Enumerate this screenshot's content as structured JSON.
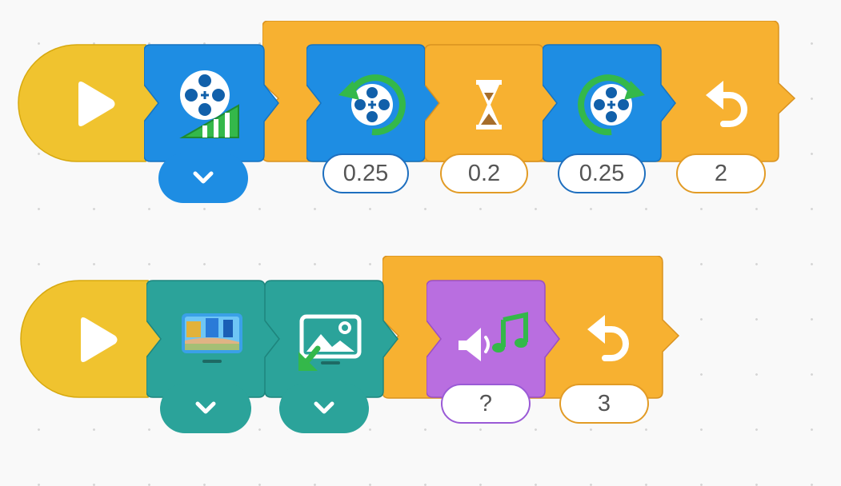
{
  "program": {
    "row1": {
      "start": {
        "icon": "play-triangle-icon",
        "color": "#f0c32f"
      },
      "motor_speed": {
        "icon": "motor-speed-icon",
        "color": "#1e8de3",
        "dropdown_icon": "chevron-down-icon"
      },
      "repeat": {
        "color": "#f7b131",
        "icon": "repeat-arrow-icon",
        "count": "2",
        "children": [
          {
            "block": "rotate-counterclockwise",
            "icon": "rotate-counterclockwise-icon",
            "color": "#1e8de3",
            "value": "0.25"
          },
          {
            "block": "wait",
            "icon": "hourglass-icon",
            "color": "#f7b131",
            "value": "0.2"
          },
          {
            "block": "rotate-clockwise",
            "icon": "rotate-clockwise-icon",
            "color": "#1e8de3",
            "value": "0.25"
          }
        ]
      }
    },
    "row2": {
      "start": {
        "icon": "play-triangle-icon",
        "color": "#f0c32f"
      },
      "set_background": {
        "icon": "background-scene-icon",
        "color": "#2ba39a",
        "dropdown_icon": "chevron-down-icon"
      },
      "add_image": {
        "icon": "add-image-icon",
        "color": "#2ba39a",
        "dropdown_icon": "chevron-down-icon"
      },
      "repeat": {
        "color": "#f7b131",
        "icon": "repeat-arrow-icon",
        "count": "3",
        "children": [
          {
            "block": "play-sound",
            "icon": "sound-music-icon",
            "color": "#b96ee0",
            "value": "?"
          }
        ]
      }
    }
  }
}
